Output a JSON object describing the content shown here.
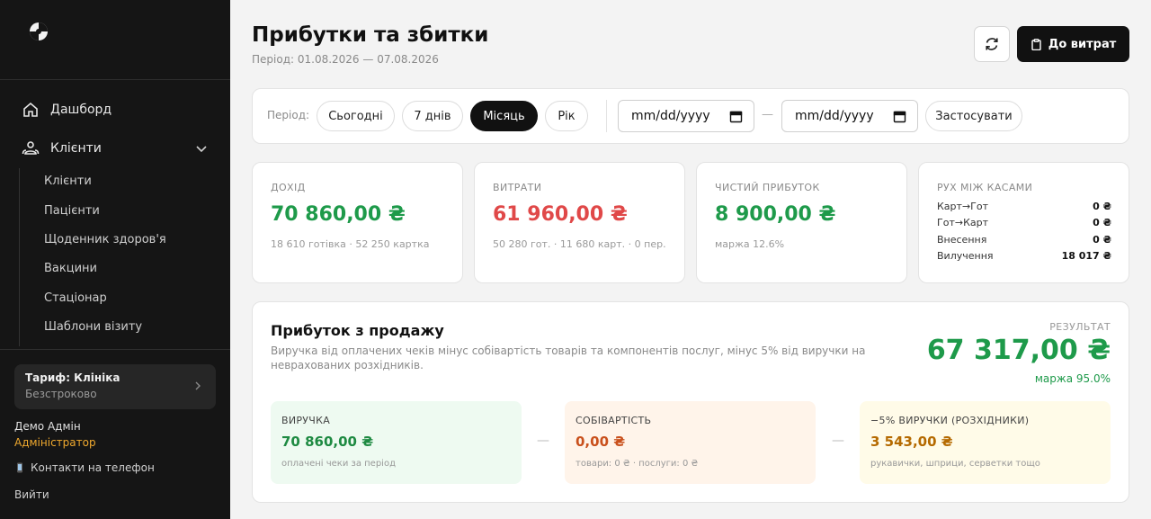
{
  "sidebar": {
    "nav": [
      {
        "label": "Дашборд",
        "icon": "home-icon"
      },
      {
        "label": "Клієнти",
        "icon": "users-icon"
      }
    ],
    "sub_items": [
      "Клієнти",
      "Пацієнти",
      "Щоденник здоров'я",
      "Вакцини",
      "Стаціонар",
      "Шаблони візиту"
    ],
    "plan": {
      "title": "Тариф: Клініка",
      "subtitle": "Безстроково"
    },
    "user": {
      "name": "Демо Адмін",
      "role": "Адміністратор"
    },
    "phone_link": "Контакти на телефон",
    "logout": "Вийти"
  },
  "header": {
    "title": "Прибутки та збитки",
    "period": "Період: 01.08.2026 — 07.08.2026",
    "expenses_button": "До витрат"
  },
  "filters": {
    "label": "Період:",
    "presets": [
      "Сьогодні",
      "7 днів",
      "Місяць",
      "Рік"
    ],
    "active_preset": "Місяць",
    "date_from": "mm/dd/yyyy",
    "date_to": "mm/dd/yyyy",
    "date_separator": "—",
    "apply": "Застосувати"
  },
  "stats": {
    "income": {
      "label": "ДОХІД",
      "value": "70 860,00 ₴",
      "note": "18 610 готівка · 52 250 картка"
    },
    "expenses": {
      "label": "ВИТРАТИ",
      "value": "61 960,00 ₴",
      "note": "50 280 гот. · 11 680 карт. · 0 пер."
    },
    "net": {
      "label": "ЧИСТИЙ ПРИБУТОК",
      "value": "8 900,00 ₴",
      "note": "маржа 12.6%"
    },
    "cash": {
      "label": "РУХ МІЖ КАСАМИ",
      "rows": [
        {
          "name": "Карт→Гот",
          "value": "0 ₴"
        },
        {
          "name": "Гот→Карт",
          "value": "0 ₴"
        },
        {
          "name": "Внесення",
          "value": "0 ₴"
        },
        {
          "name": "Вилучення",
          "value": "18 017 ₴"
        }
      ]
    }
  },
  "profit": {
    "title": "Прибуток з продажу",
    "description": "Виручка від оплачених чеків мінус собівартість товарів та компонентів послуг, мінус 5% від виручки на неврахованих розхідників.",
    "result_label": "РЕЗУЛЬТАТ",
    "result_value": "67 317,00 ₴",
    "result_margin": "маржа 95.0%",
    "separator": "—",
    "breakdown": [
      {
        "label": "ВИРУЧКА",
        "value": "70 860,00 ₴",
        "note": "оплачені чеки за період",
        "bg": "#eefaf1",
        "color": "#1e8a42"
      },
      {
        "label": "СОБІВАРТІСТЬ",
        "value": "0,00 ₴",
        "note": "товари: 0 ₴ · послуги: 0 ₴",
        "bg": "#fff4ea",
        "color": "#c9501c"
      },
      {
        "label": "−5% ВИРУЧКИ (РОЗХІДНИКИ)",
        "value": "3 543,00 ₴",
        "note": "рукавички, шприци, серветки тощо",
        "bg": "#fffbe8",
        "color": "#b56a00"
      }
    ]
  }
}
